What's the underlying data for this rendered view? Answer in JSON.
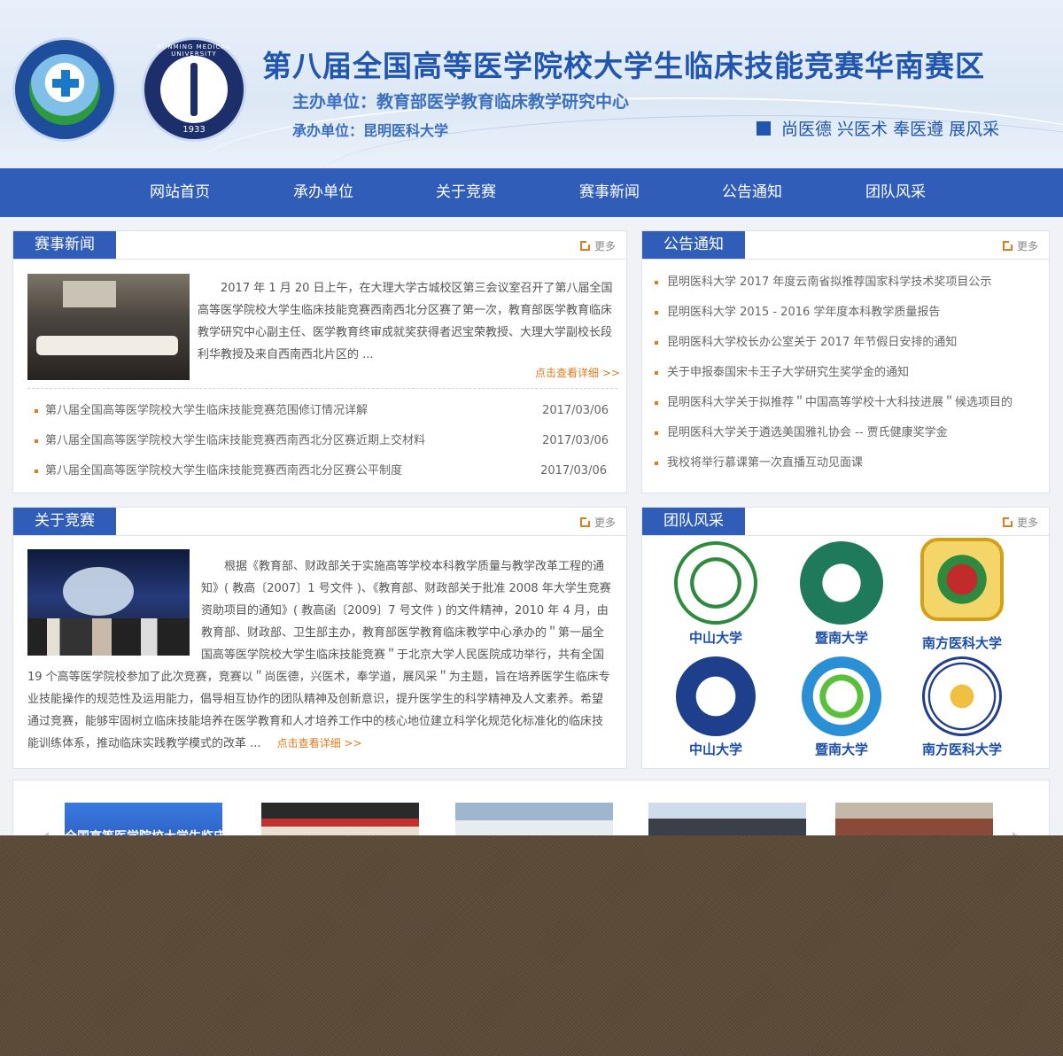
{
  "header": {
    "title": "第八届全国高等医学院校大学生临床技能竞赛华南赛区",
    "host": "主办单位：教育部医学教育临床教学研究中心",
    "organizer": "承办单位：昆明医科大学",
    "slogan": "尚医德 兴医术 奉医遵 展风采",
    "logo2_ring": "KUNMING MEDICAL UNIVERSITY",
    "logo2_year": "1933"
  },
  "nav": [
    "网站首页",
    "承办单位",
    "关于竞赛",
    "赛事新闻",
    "公告通知",
    "团队风采"
  ],
  "news": {
    "title": "赛事新闻",
    "more": "更多",
    "summary": "2017 年 1 月 20 日上午，在大理大学古城校区第三会议室召开了第八届全国高等医学院校大学生临床技能竞赛西南西北分区赛了第一次，教育部医学教育临床教学研究中心副主任、医学教育终审成就奖获得者迟宝荣教授、大理大学副校长段利华教授及来自西南西北片区的 ...",
    "detail": "点击查看详细 >>",
    "items": [
      {
        "title": "第八届全国高等医学院校大学生临床技能竞赛范围修订情况详解",
        "date": "2017/03/06"
      },
      {
        "title": "第八届全国高等医学院校大学生临床技能竞赛西南西北分区赛近期上交材料",
        "date": "2017/03/06"
      },
      {
        "title": "第八届全国高等医学院校大学生临床技能竞赛西南西北分区赛公平制度",
        "date": "2017/03/06"
      }
    ]
  },
  "notices": {
    "title": "公告通知",
    "more": "更多",
    "items": [
      "昆明医科大学 2017 年度云南省拟推荐国家科学技术奖项目公示",
      "昆明医科大学 2015 - 2016 学年度本科教学质量报告",
      "昆明医科大学校长办公室关于 2017 年节假日安排的通知",
      "关于申报泰国宋卡王子大学研究生奖学金的通知",
      "昆明医科大学关于拟推荐＂中国高等学校十大科技进展＂候选项目的",
      "昆明医科大学关于遴选美国雅礼协会 -- 贾氏健康奖学金",
      "我校将举行慕课第一次直播互动见面课"
    ]
  },
  "about": {
    "title": "关于竞赛",
    "more": "更多",
    "text": "根据《教育部、财政部关于实施高等学校本科教学质量与教学改革工程的通知》( 教高〔2007〕1 号文件 )、《教育部、财政部关于批准 2008 年大学生竞赛资助项目的通知》( 教高函〔2009〕7 号文件 ) 的文件精神，2010 年 4 月，由教育部、财政部、卫生部主办，教育部医学教育临床教学中心承办的＂第一届全国高等医学院校大学生临床技能竞赛＂于北京大学人民医院成功举行，共有全国 19 个高等医学院校参加了此次竞赛，竞赛以＂尚医德，兴医术，奉学道，展风采＂为主题，旨在培养医学生临床专业技能操作的规范性及运用能力，倡导相互协作的团队精神及创新意识，提升医学生的科学精神及人文素养。希望通过竞赛，能够牢固树立临床技能培养在医学教育和人才培养工作中的核心地位建立科学化规范化标准化的临床技能训练体系，推动临床实践教学模式的改革 ...",
    "detail": "点击查看详细 >>"
  },
  "teams": {
    "title": "团队风采",
    "more": "更多",
    "items": [
      {
        "name": "中山大学",
        "icon": "sysu-emblem",
        "color": "#2e8b3e"
      },
      {
        "name": "暨南大学",
        "icon": "jnu-emblem",
        "color": "#1f7a5c"
      },
      {
        "name": "南方医科大学",
        "icon": "smu-emblem",
        "color": "#d4a017"
      },
      {
        "name": "中山大学",
        "icon": "gzmu-emblem",
        "color": "#1d3f8c"
      },
      {
        "name": "暨南大学",
        "icon": "gdmu-emblem",
        "color": "#2a8fd4"
      },
      {
        "name": "南方医科大学",
        "icon": "gdpu-emblem",
        "color": "#233f8a"
      }
    ]
  },
  "gallery": {
    "first_caption": "全国高等医学院校大学生临床"
  }
}
